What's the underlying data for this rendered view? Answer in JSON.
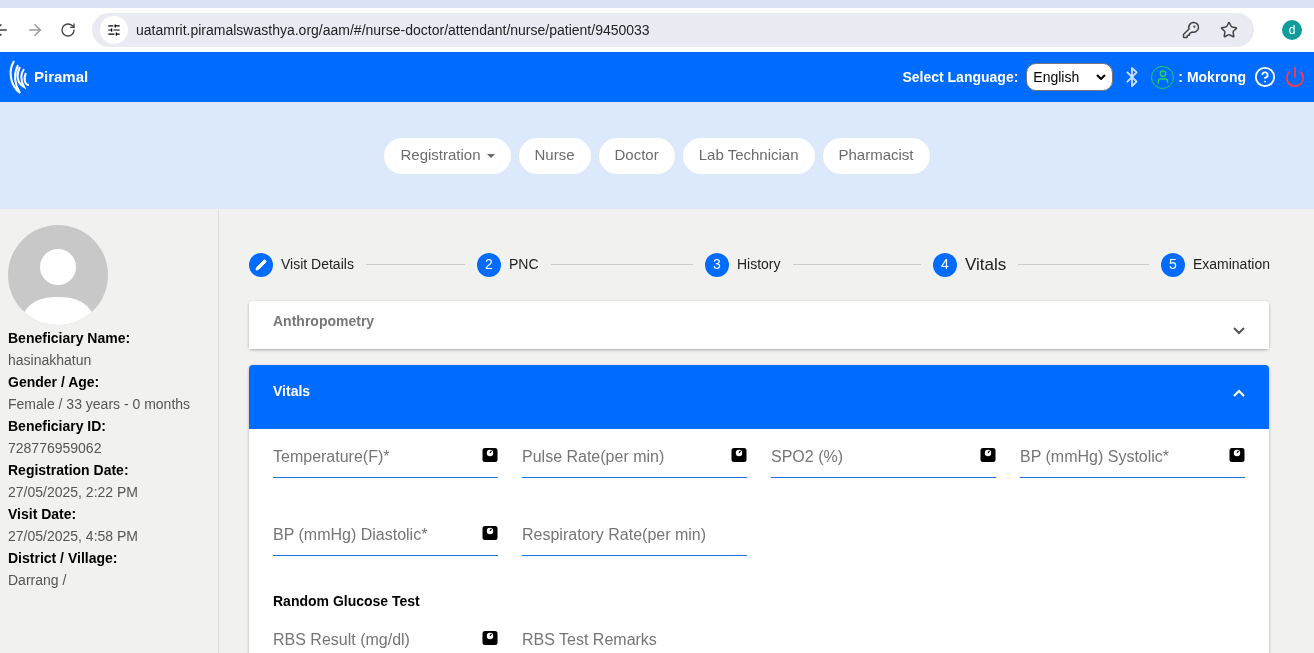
{
  "browser": {
    "url": "uatamrit.piramalswasthya.org/aam/#/nurse-doctor/attendant/nurse/patient/9450033",
    "profile_initial": "d"
  },
  "header": {
    "brand": "Piramal",
    "language_label": "Select Language:",
    "language": "English",
    "user": ": Mokrong"
  },
  "nav": [
    {
      "label": "Registration",
      "dropdown": true
    },
    {
      "label": "Nurse",
      "dropdown": false
    },
    {
      "label": "Doctor",
      "dropdown": false
    },
    {
      "label": "Lab Technician",
      "dropdown": false
    },
    {
      "label": "Pharmacist",
      "dropdown": false
    }
  ],
  "patient": [
    {
      "label": "Beneficiary Name:",
      "value": "hasinakhatun"
    },
    {
      "label": "Gender / Age:",
      "value": "Female / 33 years - 0 months"
    },
    {
      "label": "Beneficiary ID:",
      "value": "728776959062"
    },
    {
      "label": "Registration Date:",
      "value": "27/05/2025, 2:22 PM"
    },
    {
      "label": "Visit Date:",
      "value": "27/05/2025, 4:58 PM"
    },
    {
      "label": "District / Village:",
      "value": "Darrang /"
    }
  ],
  "steps": [
    {
      "kind": "edit",
      "label": "Visit Details",
      "selected": false
    },
    {
      "kind": "number",
      "number": "2",
      "label": "PNC",
      "selected": false
    },
    {
      "kind": "number",
      "number": "3",
      "label": "History",
      "selected": false
    },
    {
      "kind": "number",
      "number": "4",
      "label": "Vitals",
      "selected": true
    },
    {
      "kind": "number",
      "number": "5",
      "label": "Examination",
      "selected": false
    }
  ],
  "panels": [
    {
      "title": "Anthropometry",
      "expanded": false
    },
    {
      "title": "Vitals",
      "expanded": true
    }
  ],
  "vitals_fields": [
    {
      "placeholder": "Temperature(F)*",
      "device": true
    },
    {
      "placeholder": "Pulse Rate(per min)",
      "device": true
    },
    {
      "placeholder": "SPO2 (%)",
      "device": true
    },
    {
      "placeholder": "BP (mmHg) Systolic*",
      "device": true
    },
    {
      "placeholder": "BP (mmHg) Diastolic*",
      "device": true
    },
    {
      "placeholder": "Respiratory Rate(per min)",
      "device": false
    }
  ],
  "glucose": {
    "title": "Random Glucose Test",
    "fields": [
      {
        "placeholder": "RBS Result (mg/dl)",
        "device": true
      },
      {
        "placeholder": "RBS Test Remarks",
        "device": false
      }
    ]
  }
}
